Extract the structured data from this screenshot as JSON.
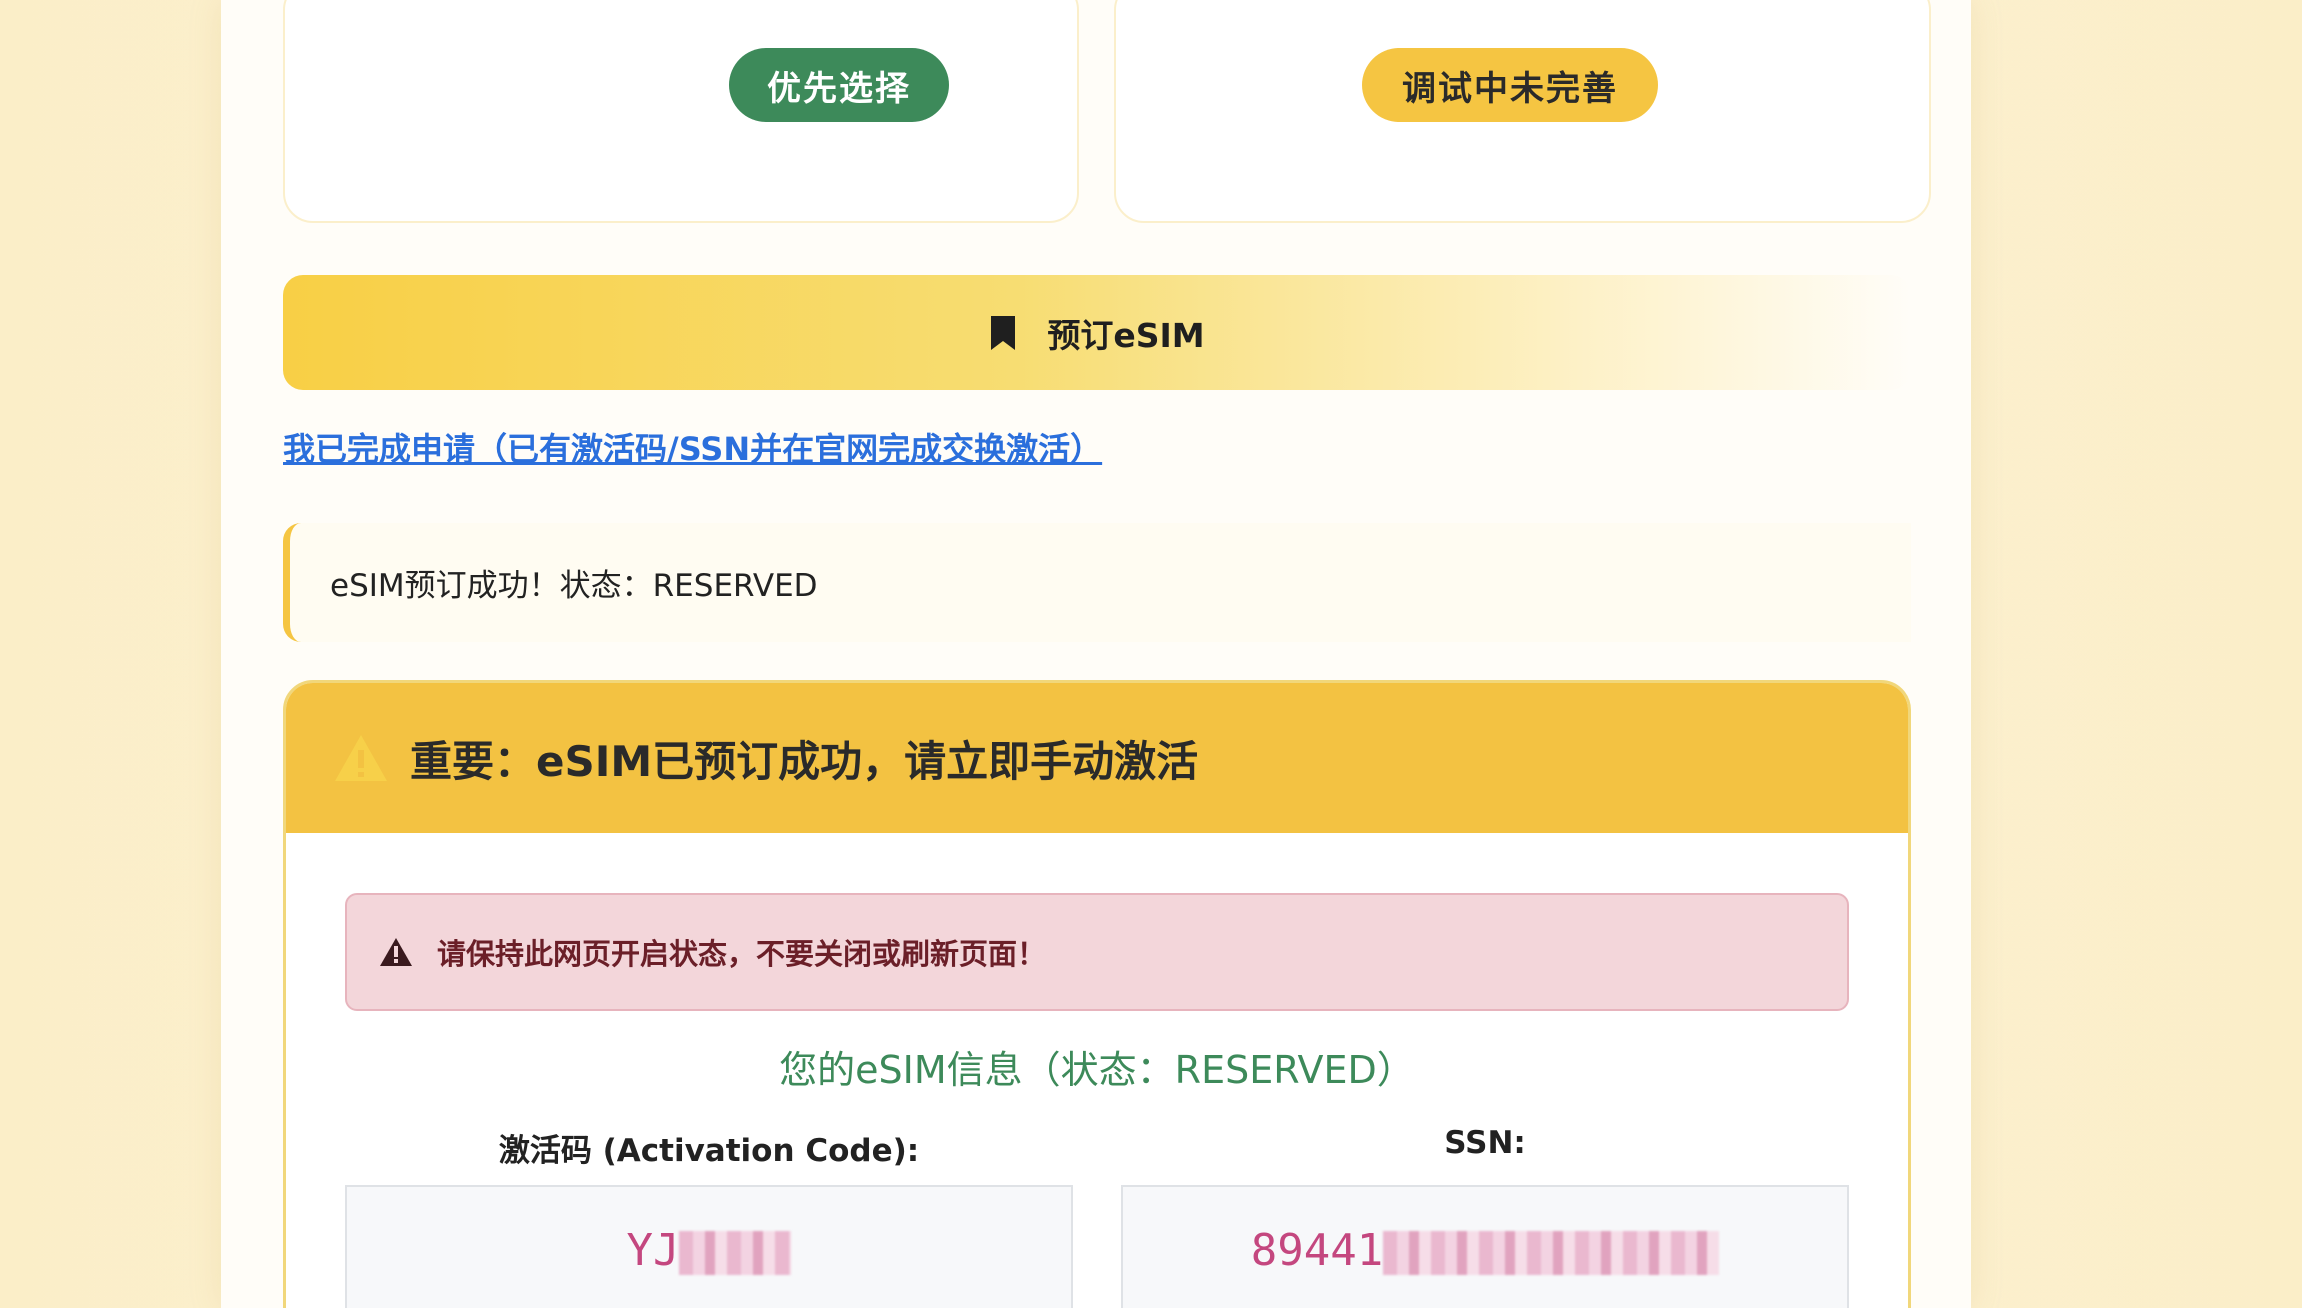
{
  "cards": {
    "left_pill": "优先选择",
    "right_pill": "调试中未完善"
  },
  "reserve": {
    "label": "预订eSIM"
  },
  "done_link": "我已完成申请（已有激活码/SSN并在官网完成交换激活）",
  "status_note": "eSIM预订成功！状态：RESERVED",
  "panel": {
    "title": "重要：eSIM已预订成功，请立即手动激活",
    "alert": "请保持此网页开启状态，不要关闭或刷新页面！",
    "info_title": "您的eSIM信息（状态：RESERVED）",
    "activation_label": "激活码 (Activation Code):",
    "activation_prefix": "YJ",
    "ssn_label": "SSN:",
    "ssn_prefix": "89441"
  },
  "colors": {
    "green": "#3d8a5a",
    "yellow": "#f5c542",
    "link": "#2b6fdc",
    "alert_bg": "#f3d6da",
    "code_text": "#c4477f"
  },
  "icons": {
    "reserve": "bookmark-icon",
    "panel_head": "warning-icon",
    "alert": "warning-icon"
  }
}
